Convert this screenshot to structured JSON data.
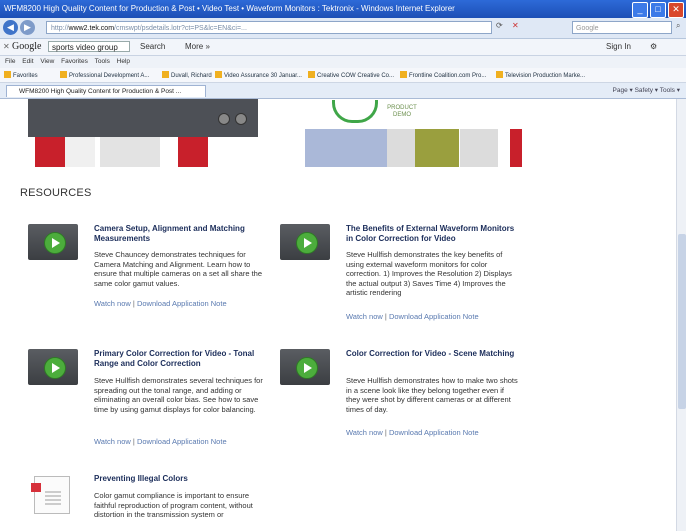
{
  "window": {
    "title": "WFM8200 High Quality Content for Production & Post • Video Test • Waveform Monitors : Tektronix - Windows Internet Explorer"
  },
  "address": {
    "url_prefix": "http://",
    "url_host": "www2.tek.com",
    "url_rest": "/cmswpt/psdetails.lotr?ct=PS&lc=EN&ci=...",
    "live_search_placeholder": "Google"
  },
  "googlebar": {
    "logo": "Google",
    "query": "sports video group",
    "search_label": "Search",
    "more_label": "More »",
    "signin_label": "Sign In"
  },
  "menu": [
    "File",
    "Edit",
    "View",
    "Favorites",
    "Tools",
    "Help"
  ],
  "favorites": {
    "label": "Favorites",
    "items": [
      "Professional Development A...",
      "Duvall, Richard",
      "Video Assurance 30 Januar...",
      "Creative COW Creative Co...",
      "Frontline Coalition.com Pro...",
      "Television Production Marke..."
    ]
  },
  "tab": {
    "label": "WFM8200 High Quality Content for Production & Post ...",
    "tools": "Page ▾  Safety ▾  Tools ▾"
  },
  "banner": {
    "demo_label_1": "PRODUCT",
    "demo_label_2": "DEMO"
  },
  "resources": {
    "heading": "RESOURCES",
    "watch_label": "Watch now",
    "separator": "|",
    "download_label": "Download Application Note",
    "items": [
      {
        "title": "Camera Setup, Alignment and Matching Measurements",
        "description": "Steve Chauncey demonstrates techniques for Camera Matching and Alignment. Learn how to ensure that multiple cameras on a set all share the same color gamut values."
      },
      {
        "title": "The Benefits of External Waveform Monitors in Color Correction for Video",
        "description": "Steve Hullfish demonstrates the key benefits of using external waveform monitors for color correction. 1) Improves the Resolution 2) Displays the actual output 3) Saves Time 4) Improves the artistic rendering"
      },
      {
        "title": "Primary Color Correction for Video - Tonal Range and Color Correction",
        "description": "Steve Hullfish demonstrates several techniques for spreading out the tonal range, and adding or eliminating an overall color bias. See how to save time by using gamut displays for color balancing."
      },
      {
        "title": "Color Correction for Video - Scene Matching",
        "description": "Steve Hullfish demonstrates how to make two shots in a scene look like they belong together even if they were shot by different cameras or at different times of day."
      },
      {
        "title": "Preventing Illegal Colors",
        "description": "Color gamut compliance is important to ensure faithful reproduction of program content, without distortion in the transmission system or"
      }
    ]
  }
}
